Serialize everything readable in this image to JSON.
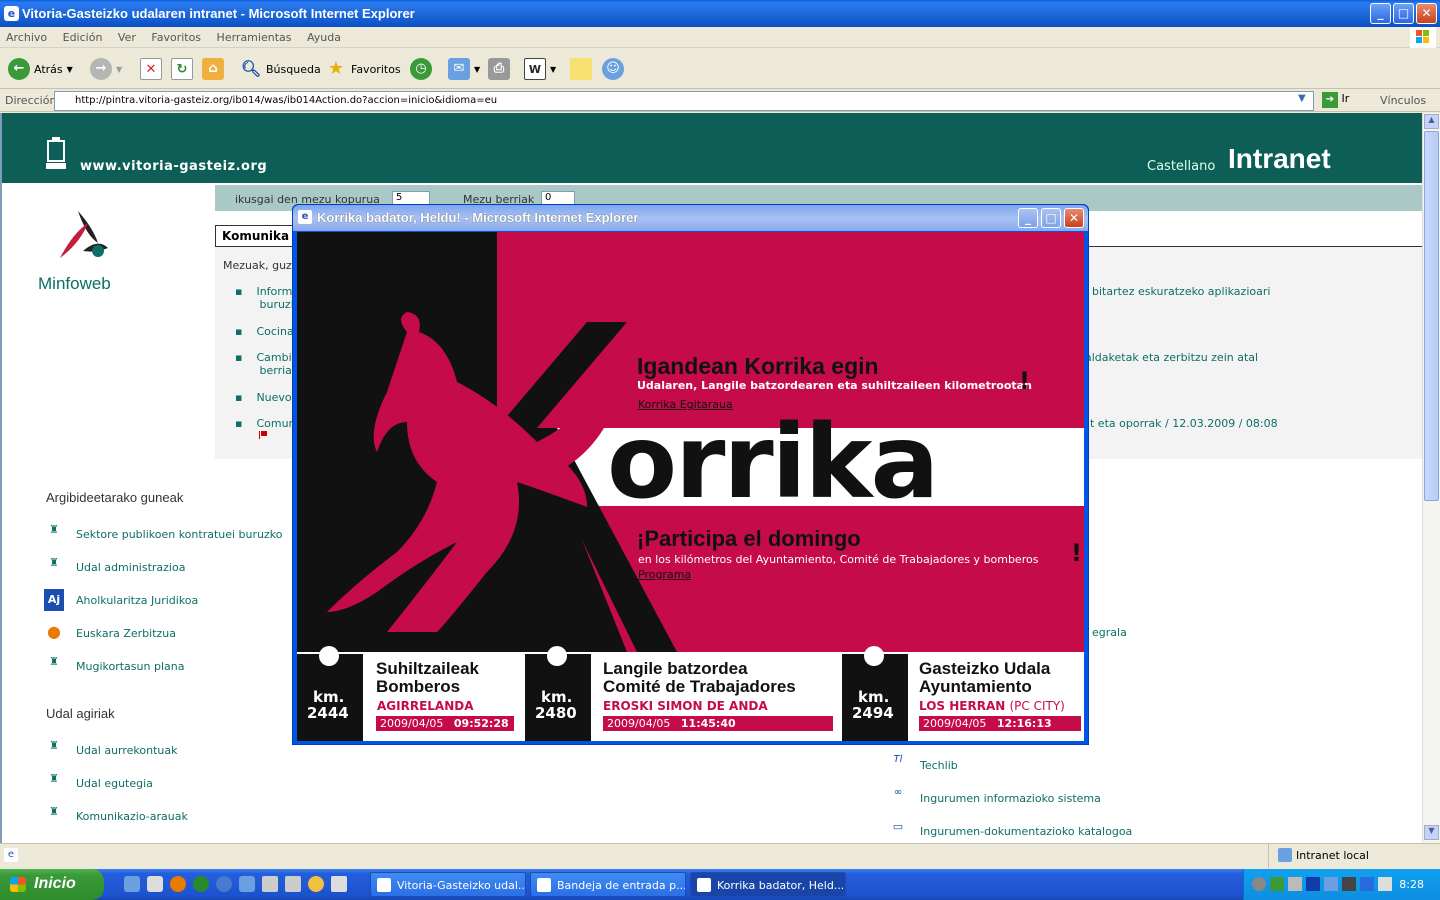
{
  "window": {
    "title": "Vitoria-Gasteizko udalaren intranet - Microsoft Internet Explorer"
  },
  "menu": [
    "Archivo",
    "Edición",
    "Ver",
    "Favoritos",
    "Herramientas",
    "Ayuda"
  ],
  "toolbar": {
    "back": "Atrás",
    "search": "Búsqueda",
    "favorites": "Favoritos"
  },
  "address": {
    "label": "Dirección",
    "url": "http://pintra.vitoria-gasteiz.org/ib014/was/ib014Action.do?accion=inicio&idioma=eu",
    "go": "Ir",
    "links": "Vínculos"
  },
  "page": {
    "site_url": "www.vitoria-gasteiz.org",
    "lang_link": "Castellano",
    "intranet_title": "Intranet",
    "app_name": "Minfoweb",
    "filter_label_1": "ikusgai den mezu kopurua",
    "filter_value_1": "5",
    "filter_label_2": "Mezu berriak",
    "filter_value_2": "0",
    "tab_label": "Komunika",
    "messages_intro": "Mezuak, guz",
    "messages": [
      {
        "left": "Inform",
        "left2": "buruzk",
        "right": "bitartez eskuratzeko aplikazioari"
      },
      {
        "left": "Cocina",
        "left2": "",
        "right": ""
      },
      {
        "left": "Cambi",
        "left2": "berrial",
        "right": "aldaketak eta zerbitzu zein atal"
      },
      {
        "left": "Nuevo",
        "left2": "",
        "right": ""
      },
      {
        "left": "Comun",
        "left2": "",
        "right": "t eta oporrak / 12.03.2009 / 08:08"
      }
    ],
    "sections": [
      {
        "title": "Argibideetarako guneak",
        "links": [
          "Sektore publikoen kontratuei buruzko",
          "Udal administrazioa",
          "Aholkularitza Juridikoa",
          "Euskara Zerbitzua",
          "Mugikortasun plana"
        ]
      },
      {
        "title": "Udal agiriak",
        "links": [
          "Udal aurrekontuak",
          "Udal egutegia",
          "Komunikazio-arauak"
        ]
      }
    ],
    "right_links": [
      "egrala",
      "Techlib",
      "Ingurumen informazioko sistema",
      "Ingurumen-dokumentazioko katalogoa"
    ]
  },
  "popup": {
    "title": "Korrika badator, Heldu! - Microsoft Internet Explorer",
    "headline_eu": "Igandean Korrika egin",
    "sub_eu": "Udalaren, Langile batzordearen  eta suhiltzaileen kilometrootan",
    "link_eu": "Korrika Egitaraua",
    "big_word": "orrika",
    "headline_es": "¡Participa el domingo",
    "sub_es": "en los kilómetros del Ayuntamiento, Comité de Trabajadores y bomberos",
    "link_es": "Programa",
    "excl": "!",
    "tickets": [
      {
        "km_label": "km.",
        "km": "2444",
        "line1": "Suhiltzaileak",
        "line2": "Bomberos",
        "place": "AGIRRELANDA",
        "place2": "",
        "date": "2009/04/05",
        "time": "09:52:28"
      },
      {
        "km_label": "km.",
        "km": "2480",
        "line1": "Langile batzordea",
        "line2": "Comité de Trabajadores",
        "place": "EROSKI SIMON DE ANDA",
        "place2": "",
        "date": "2009/04/05",
        "time": "11:45:40"
      },
      {
        "km_label": "km.",
        "km": "2494",
        "line1": "Gasteizko Udala",
        "line2": "Ayuntamiento",
        "place": "LOS HERRAN",
        "place2": "(PC CITY)",
        "date": "2009/04/05",
        "time": "12:16:13"
      }
    ]
  },
  "status": {
    "zone": "Intranet local"
  },
  "taskbar": {
    "start": "Inicio",
    "tasks": [
      "Vitoria-Gasteizko udal...",
      "Bandeja de entrada p...",
      "Korrika badator, Held..."
    ],
    "clock": "8:28"
  },
  "colors": {
    "brand_teal": "#0c5e57",
    "korrika_red": "#c60b4b",
    "xp_blue": "#245edb"
  }
}
